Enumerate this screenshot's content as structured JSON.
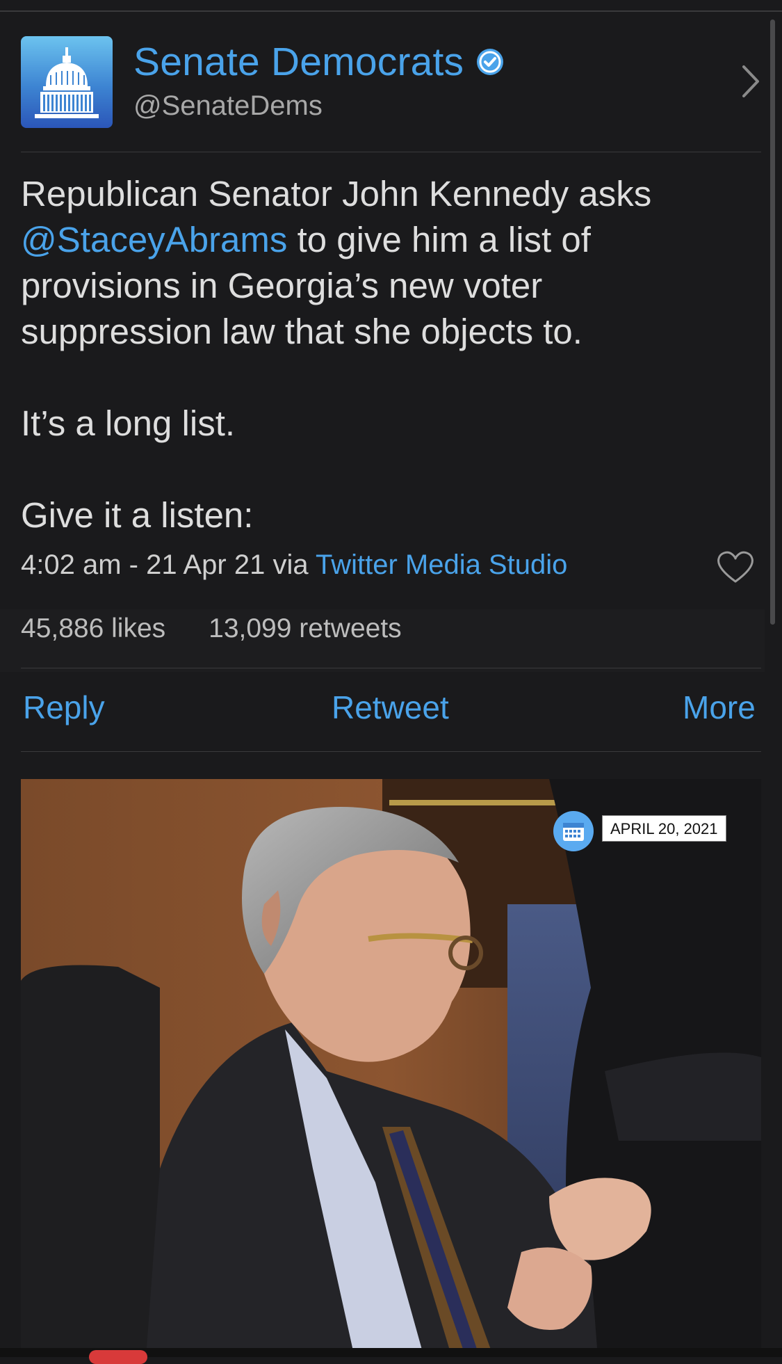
{
  "account": {
    "display_name": "Senate Democrats",
    "handle": "@SenateDems",
    "verified": true,
    "avatar_icon": "capitol-dome-icon"
  },
  "tweet": {
    "line1_a": "Republican Senator John Kennedy asks",
    "mention": "@StaceyAbrams",
    "line2_b": " to give him a list of",
    "line3": "provisions in Georgia’s new voter",
    "line4": "suppression law that she objects to.",
    "para2": "It’s a long list.",
    "para3": "Give it a listen:"
  },
  "meta": {
    "time": "4:02 am - 21 Apr 21 via ",
    "source": "Twitter Media Studio"
  },
  "stats": {
    "likes": "45,886 likes",
    "retweets": "13,099 retweets"
  },
  "actions": {
    "reply": "Reply",
    "retweet": "Retweet",
    "more": "More"
  },
  "media": {
    "date_label": "APRIL 20, 2021",
    "calendar_icon": "calendar-icon"
  },
  "colors": {
    "accent": "#4aa3ea",
    "background": "#1a1a1c",
    "text": "#dedede"
  }
}
